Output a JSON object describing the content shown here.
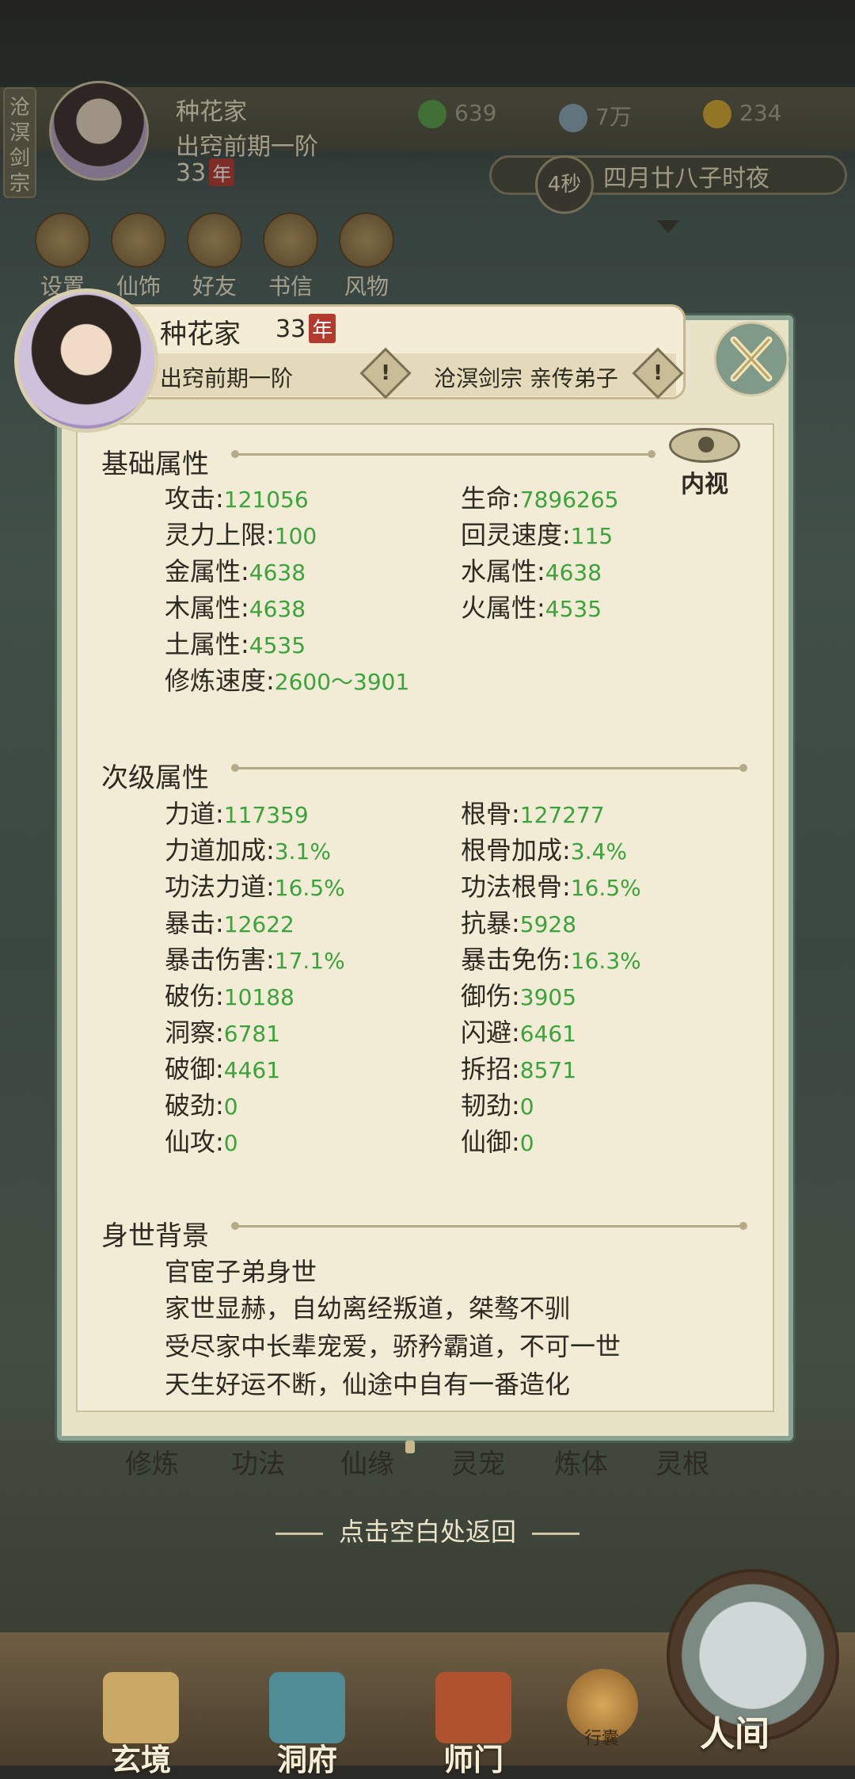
{
  "hud": {
    "sect_tab": "沧溟剑宗",
    "name": "种花家",
    "realm": "出窍前期一阶",
    "age": "33",
    "age_unit": "年",
    "resources": [
      {
        "icon": "leaf-icon",
        "value": "639",
        "color": "#5aa04a"
      },
      {
        "icon": "coin-icon",
        "value": "7万",
        "color": "#8aa6b6"
      },
      {
        "icon": "gold-ingot-icon",
        "value": "234",
        "color": "#d8a830"
      }
    ],
    "time_seconds": "4秒",
    "date_text": "四月廿八子时夜",
    "menu": [
      "设置",
      "仙饰",
      "好友",
      "书信",
      "风物"
    ]
  },
  "panel": {
    "name": "种花家",
    "age": "33",
    "age_unit": "年",
    "realm": "出窍前期一阶",
    "sect": "沧溟剑宗 亲传弟子",
    "inner_view": "内视",
    "basic_title": "基础属性",
    "basic": [
      {
        "label": "攻击",
        "value": "121056"
      },
      {
        "label": "生命",
        "value": "7896265"
      },
      {
        "label": "灵力上限",
        "value": "100"
      },
      {
        "label": "回灵速度",
        "value": "115"
      },
      {
        "label": "金属性",
        "value": "4638"
      },
      {
        "label": "水属性",
        "value": "4638"
      },
      {
        "label": "木属性",
        "value": "4638"
      },
      {
        "label": "火属性",
        "value": "4535"
      },
      {
        "label": "土属性",
        "value": "4535"
      },
      {
        "label": "修炼速度",
        "value": "2600～3901"
      }
    ],
    "secondary_title": "次级属性",
    "secondary": [
      {
        "label": "力道",
        "value": "117359"
      },
      {
        "label": "根骨",
        "value": "127277"
      },
      {
        "label": "力道加成",
        "value": "3.1%"
      },
      {
        "label": "根骨加成",
        "value": "3.4%"
      },
      {
        "label": "功法力道",
        "value": "16.5%"
      },
      {
        "label": "功法根骨",
        "value": "16.5%"
      },
      {
        "label": "暴击",
        "value": "12622"
      },
      {
        "label": "抗暴",
        "value": "5928"
      },
      {
        "label": "暴击伤害",
        "value": "17.1%"
      },
      {
        "label": "暴击免伤",
        "value": "16.3%"
      },
      {
        "label": "破伤",
        "value": "10188"
      },
      {
        "label": "御伤",
        "value": "3905"
      },
      {
        "label": "洞察",
        "value": "6781"
      },
      {
        "label": "闪避",
        "value": "6461"
      },
      {
        "label": "破御",
        "value": "4461"
      },
      {
        "label": "拆招",
        "value": "8571"
      },
      {
        "label": "破劲",
        "value": "0"
      },
      {
        "label": "韧劲",
        "value": "0"
      },
      {
        "label": "仙攻",
        "value": "0"
      },
      {
        "label": "仙御",
        "value": "0"
      }
    ],
    "background_title": "身世背景",
    "background": [
      "官宦子弟身世",
      "家世显赫，自幼离经叛道，桀骜不驯",
      "受尽家中长辈宠爱，骄矜霸道，不可一世",
      "天生好运不断，仙途中自有一番造化"
    ]
  },
  "hidden_tabs": [
    "修炼",
    "功法",
    "仙缘",
    "灵宠",
    "炼体",
    "灵根"
  ],
  "return_hint": "点击空白处返回",
  "bottom_nav": [
    "玄境",
    "洞府",
    "师门",
    "行囊",
    "人间"
  ]
}
